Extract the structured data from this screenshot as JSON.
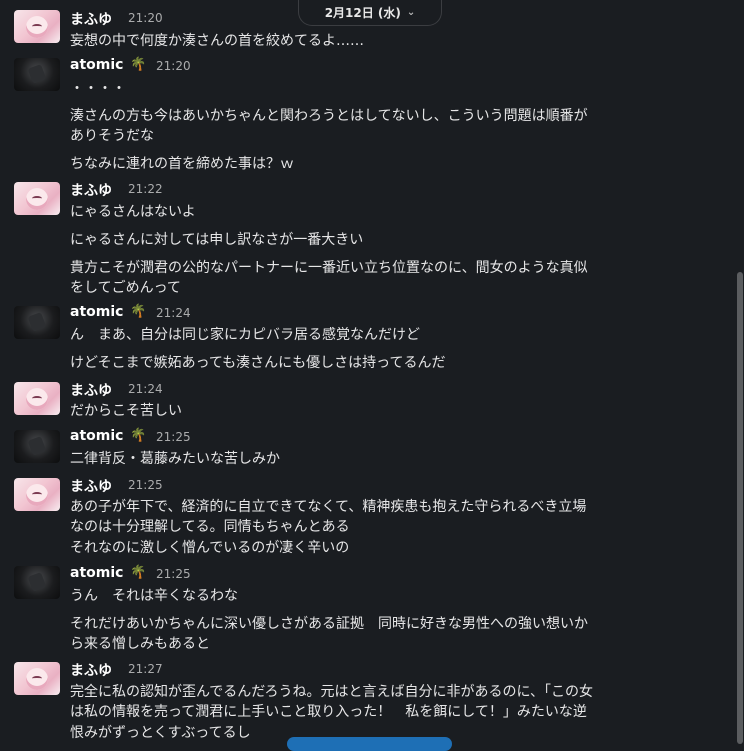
{
  "date_divider": {
    "label": "2月12日 (水)"
  },
  "messages": [
    {
      "user": "まふゆ",
      "avatar": "mafuyu",
      "emoji": "",
      "time": "21:20",
      "lines": [
        "妄想の中で何度か湊さんの首を絞めてるよ……"
      ]
    },
    {
      "user": "atomic",
      "avatar": "atomic",
      "emoji": "🌴",
      "time": "21:20",
      "lines": [
        "・・・・",
        "湊さんの方も今はあいかちゃんと関わろうとはしてないし、こういう問題は順番が",
        "ありそうだな",
        "ちなみに連れの首を締めた事は？ｗ"
      ]
    },
    {
      "user": "まふゆ",
      "avatar": "mafuyu",
      "emoji": "",
      "time": "21:22",
      "lines": [
        "にゃるさんはないよ",
        "にゃるさんに対しては申し訳なさが一番大きい",
        "貴方こそが潤君の公的なパートナーに一番近い立ち位置なのに、間女のような真似",
        "をしてごめんって"
      ]
    },
    {
      "user": "atomic",
      "avatar": "atomic",
      "emoji": "🌴",
      "time": "21:24",
      "lines": [
        "ん　まあ、自分は同じ家にカピバラ居る感覚なんだけど",
        "けどそこまで嫉妬あっても湊さんにも優しさは持ってるんだ"
      ]
    },
    {
      "user": "まふゆ",
      "avatar": "mafuyu",
      "emoji": "",
      "time": "21:24",
      "lines": [
        "だからこそ苦しい"
      ]
    },
    {
      "user": "atomic",
      "avatar": "atomic",
      "emoji": "🌴",
      "time": "21:25",
      "lines": [
        "二律背反・葛藤みたいな苦しみか"
      ]
    },
    {
      "user": "まふゆ",
      "avatar": "mafuyu",
      "emoji": "",
      "time": "21:25",
      "lines": [
        "あの子が年下で、経済的に自立できてなくて、精神疾患も抱えた守られるべき立場",
        "なのは十分理解してる。同情もちゃんとある",
        "それなのに激しく憎んでいるのが凄く辛いの"
      ]
    },
    {
      "user": "atomic",
      "avatar": "atomic",
      "emoji": "🌴",
      "time": "21:25",
      "lines": [
        "うん　それは辛くなるわな",
        "それだけあいかちゃんに深い優しさがある証拠　同時に好きな男性への強い想いか",
        "ら来る憎しみもあると"
      ]
    },
    {
      "user": "まふゆ",
      "avatar": "mafuyu",
      "emoji": "",
      "time": "21:27",
      "lines": [
        "完全に私の認知が歪んでるんだろうね。元はと言えば自分に非があるのに、「この女",
        "は私の情報を売って潤君に上手いこと取り入った！　私を餌にして！」みたいな逆",
        "恨みがずっとくすぶってるし"
      ]
    }
  ]
}
